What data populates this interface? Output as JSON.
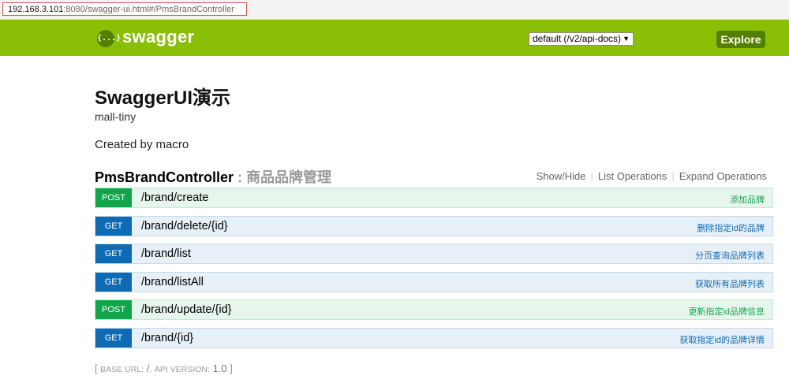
{
  "browser": {
    "url_host": "192.168.3.101",
    "url_rest": ":8080/swagger-ui.html#/PmsBrandController"
  },
  "header": {
    "logo_glyph": "{...}",
    "brand": "swagger",
    "spec_select": "default (/v2/api-docs)",
    "explore_label": "Explore",
    "colors": {
      "bar": "#89bf04",
      "explore": "#547f00"
    }
  },
  "info": {
    "title": "SwaggerUI演示",
    "subtitle": "mall-tiny",
    "created": "Created by macro"
  },
  "resource": {
    "name": "PmsBrandController",
    "separator": ":",
    "description": "商品品牌管理",
    "links": [
      "Show/Hide",
      "List Operations",
      "Expand Operations"
    ]
  },
  "operations": [
    {
      "method": "POST",
      "path": "/brand/create",
      "summary": "添加品牌"
    },
    {
      "method": "GET",
      "path": "/brand/delete/{id}",
      "summary": "删除指定id的品牌"
    },
    {
      "method": "GET",
      "path": "/brand/list",
      "summary": "分页查询品牌列表"
    },
    {
      "method": "GET",
      "path": "/brand/listAll",
      "summary": "获取所有品牌列表"
    },
    {
      "method": "POST",
      "path": "/brand/update/{id}",
      "summary": "更新指定id品牌信息"
    },
    {
      "method": "GET",
      "path": "/brand/{id}",
      "summary": "获取指定id的品牌详情"
    }
  ],
  "footer": {
    "open": "[",
    "base_label": "BASE URL:",
    "base_value": "/",
    "comma": ",",
    "version_label": "API VERSION:",
    "version_value": "1.0",
    "close": "]"
  }
}
